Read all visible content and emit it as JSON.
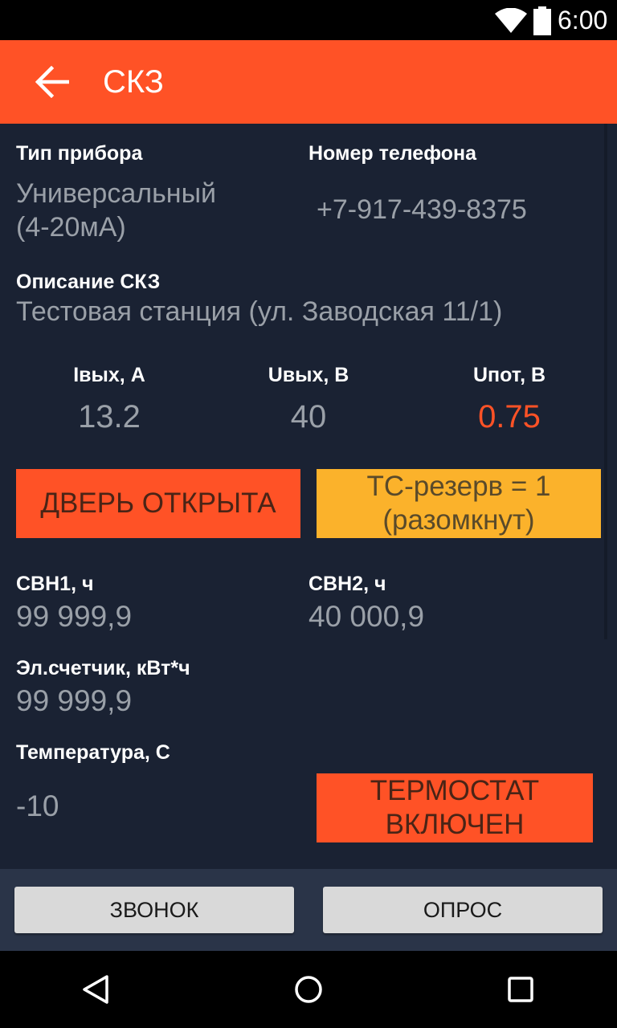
{
  "status_bar": {
    "time": "6:00",
    "icons": [
      "wifi-icon",
      "battery-icon"
    ]
  },
  "app_bar": {
    "title": "СКЗ",
    "back_icon": "arrow-back-icon",
    "color": "#ff5226"
  },
  "device": {
    "type_label": "Тип прибора",
    "type_value_line1": "Универсальный",
    "type_value_line2": "(4-20мА)",
    "phone_label": "Номер телефона",
    "phone_value": "+7-917-439-8375",
    "description_label": "Описание СКЗ",
    "description_value": "Тестовая станция (ул. Заводская 11/1)"
  },
  "measurements": [
    {
      "label": "Iвых, А",
      "value": "13.2",
      "color": "#9aa0a8"
    },
    {
      "label": "Uвых, В",
      "value": "40",
      "color": "#9aa0a8"
    },
    {
      "label": "Uпот, В",
      "value": "0.75",
      "color": "#ff5226"
    }
  ],
  "alerts": {
    "door": "ДВЕРЬ ОТКРЫТА",
    "tc_line1": "ТС-резерв = 1",
    "tc_line2": "(разомкнут)",
    "thermostat_line1": "ТЕРМОСТАТ",
    "thermostat_line2": "ВКЛЮЧЕН",
    "red_color": "#ff5226",
    "yellow_color": "#fbb22b"
  },
  "counters": {
    "svn1_label": "СВН1, ч",
    "svn1_value": "99 999,9",
    "svn2_label": "СВН2, ч",
    "svn2_value": "40 000,9",
    "meter_label": "Эл.счетчик, кВт*ч",
    "meter_value": "99 999,9",
    "temp_label": "Температура, С",
    "temp_value": "-10"
  },
  "actions": {
    "call": "ЗВОНОК",
    "poll": "ОПРОС"
  },
  "nav_bar": {
    "icons": [
      "back-triangle-icon",
      "home-circle-icon",
      "recents-square-icon"
    ]
  }
}
